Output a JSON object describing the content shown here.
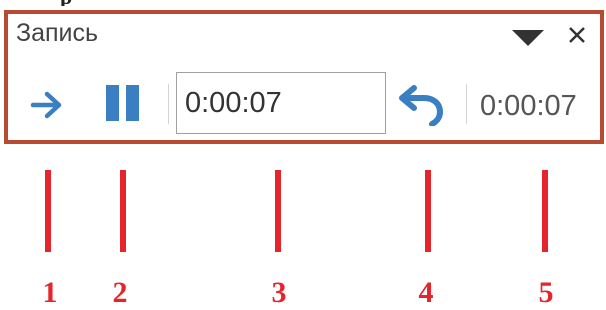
{
  "caption_fragment": "р",
  "dialog": {
    "title": "Запись",
    "position_value": "0:00:07",
    "total_time": "0:00:07"
  },
  "icons": {
    "dropdown": "chevron-down-icon",
    "close": "close-icon",
    "play": "arrow-right-icon",
    "pause": "pause-icon",
    "undo": "undo-icon"
  },
  "colors": {
    "frame": "#b84a34",
    "accent_blue": "#3a7fc1",
    "marker_red": "#e6242b"
  },
  "markers": [
    {
      "label": "1"
    },
    {
      "label": "2"
    },
    {
      "label": "3"
    },
    {
      "label": "4"
    },
    {
      "label": "5"
    }
  ]
}
